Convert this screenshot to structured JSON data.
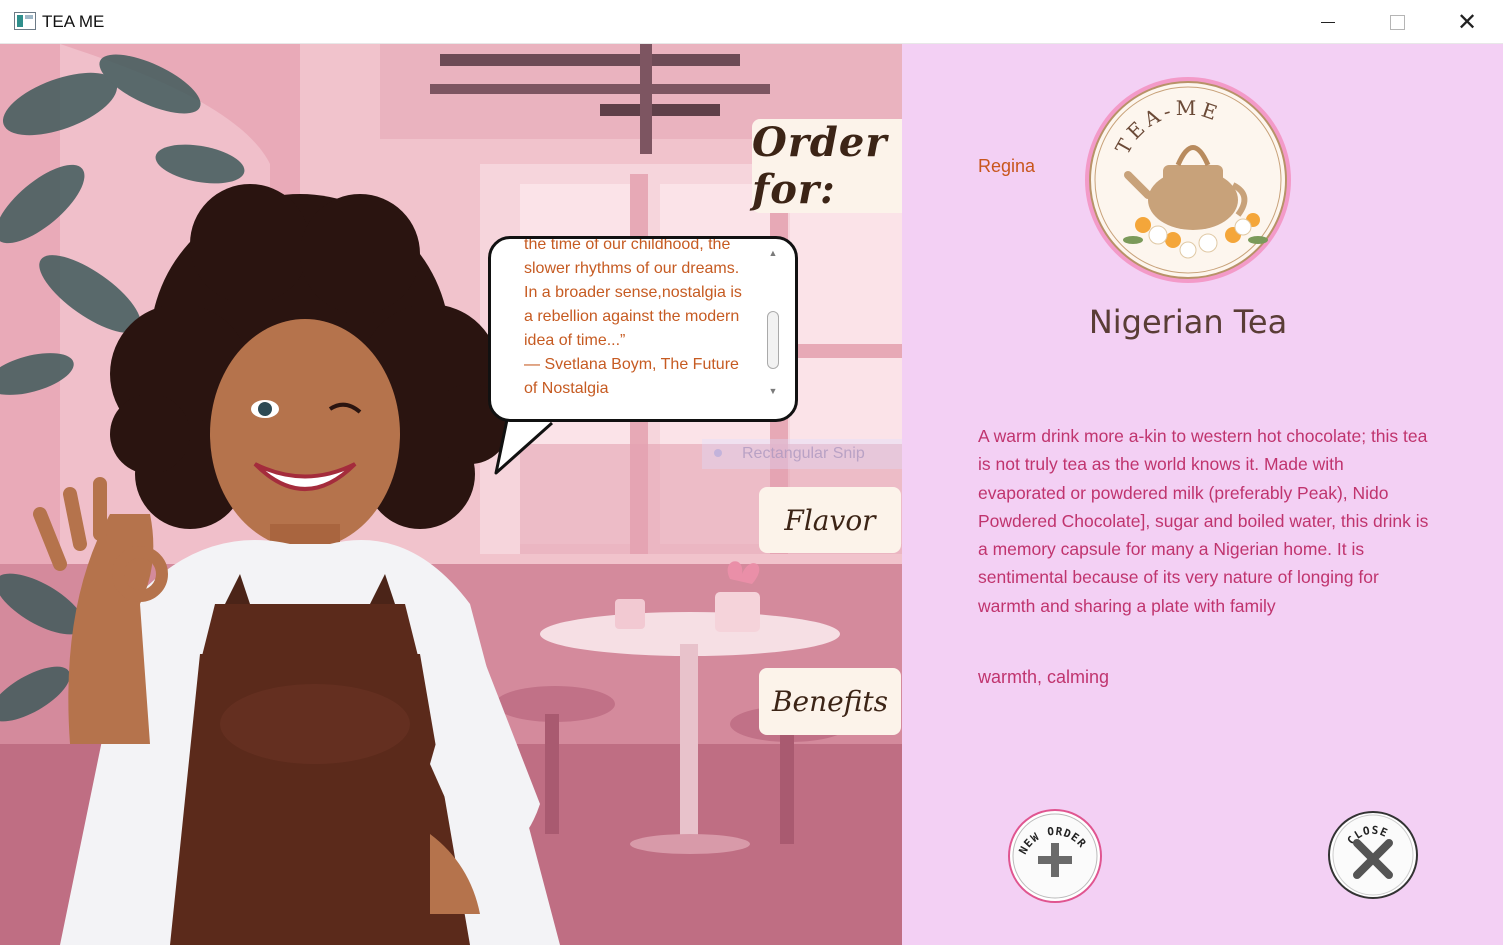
{
  "window": {
    "title": "TEA ME",
    "minimize": "—",
    "maximize": "☐",
    "close": "✕"
  },
  "order": {
    "label": "Order for:",
    "customer": "Regina"
  },
  "quote": {
    "lines": [
      "the time of our childhood, the",
      "slower rhythms of our dreams.",
      "In a broader sense,nostalgia is",
      "a rebellion against the modern",
      "idea of time...”",
      "— Svetlana Boym, The Future",
      "of Nostalgia"
    ],
    "scroll_up": "▲",
    "scroll_down": "▼"
  },
  "overlay": {
    "snip_label": "Rectangular Snip"
  },
  "cards": {
    "flavor": "Flavor",
    "benefits": "Benefits"
  },
  "logo": {
    "text": "TEA-ME"
  },
  "tea": {
    "name": "Nigerian Tea",
    "description": "A warm drink more a-kin to western hot chocolate; this tea is not truly tea as the world knows it. Made with evaporated or powdered milk (preferably Peak), Nido Powdered Chocolate], sugar and boiled water, this drink is a memory capsule for many a Nigerian home. It is sentimental because of its very nature of longing for warmth and sharing a plate with family",
    "flavor": "warmth, calming"
  },
  "buttons": {
    "new_order": "NEW ORDER",
    "close": "CLOSE"
  },
  "colors": {
    "panel_bg": "#f3d0f4",
    "accent_text": "#c0346e",
    "name_text": "#c8561c",
    "card_bg": "#fcf3ea"
  },
  "icons": {
    "window_minimize": "minimize-icon",
    "window_maximize": "maximize-icon",
    "window_close": "close-icon",
    "new_order": "plus-icon",
    "close_app": "x-icon"
  }
}
